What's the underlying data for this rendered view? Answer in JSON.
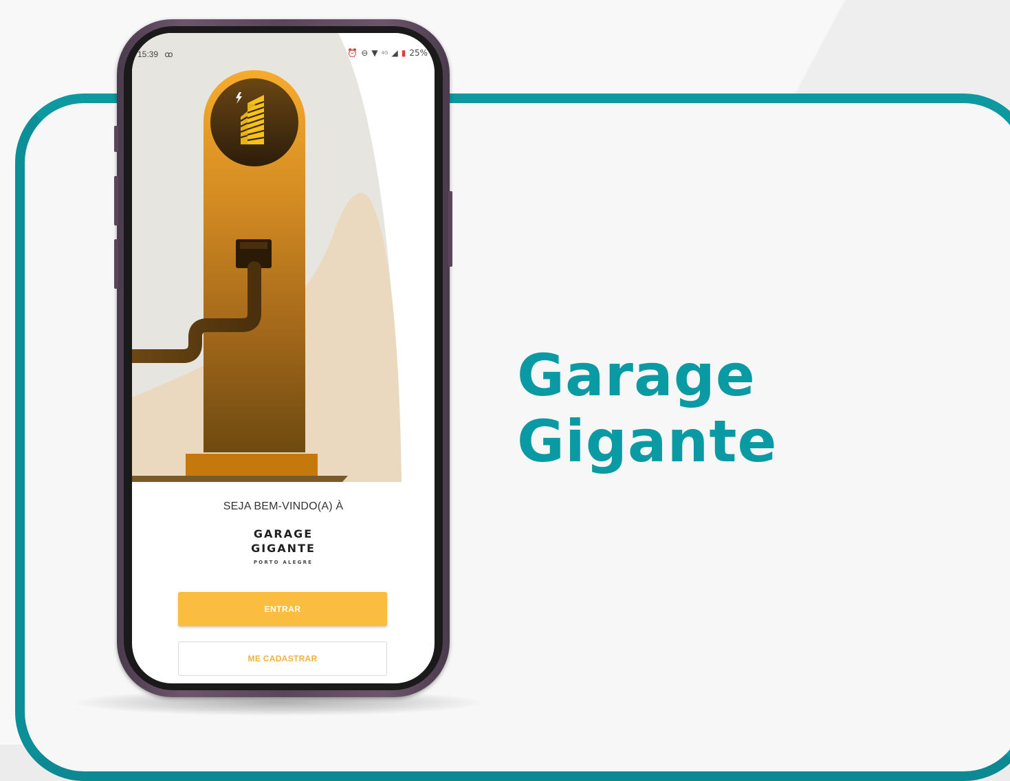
{
  "headline": {
    "line1": "Garage",
    "line2": "Gigante"
  },
  "phone": {
    "status_bar": {
      "time": "15:39",
      "voicemail_glyph": "ꝏ",
      "battery": "25%",
      "network": "4G",
      "icons": [
        "voicemail-icon",
        "alarm-icon",
        "do-not-disturb-icon",
        "wifi-icon",
        "signal-icon",
        "battery-icon"
      ]
    },
    "welcome_text": "SEJA BEM-VINDO(A) À",
    "brand": {
      "line1": "GARAGE",
      "line2": "GIGANTE",
      "location": "PORTO ALEGRE"
    },
    "buttons": {
      "login_label": "ENTRAR",
      "signup_label": "ME CADASTRAR"
    }
  },
  "colors": {
    "accent_teal": "#0a9aa3",
    "button_yellow": "#fbbd3f",
    "charger_orange": "#f4a62a",
    "charger_brown": "#6b4a10"
  }
}
